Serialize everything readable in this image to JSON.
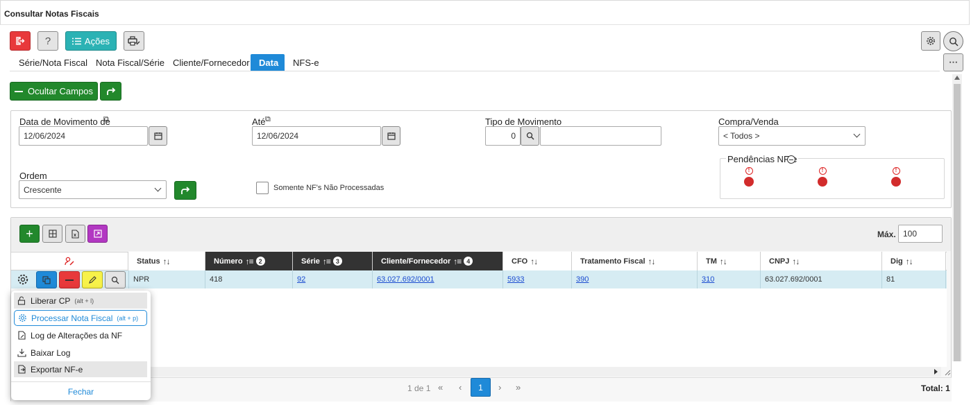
{
  "window": {
    "title": "Consultar Notas Fiscais"
  },
  "toolbar": {
    "acoes_label": "Ações",
    "help_label": "?"
  },
  "tabs": [
    {
      "label": "Série/Nota Fiscal",
      "active": false
    },
    {
      "label": "Nota Fiscal/Série",
      "active": false
    },
    {
      "label": "Cliente/Fornecedor",
      "active": false
    },
    {
      "label": "Data",
      "active": true
    },
    {
      "label": "NFS-e",
      "active": false
    }
  ],
  "actions": {
    "hide_fields_label": "Ocultar Campos"
  },
  "filters": {
    "data_mov_label": "Data de Movimento de",
    "data_mov_value": "12/06/2024",
    "ate_label": "Até",
    "ate_value": "12/06/2024",
    "tipo_mov_label": "Tipo de Movimento",
    "tipo_mov_value": "0",
    "compra_venda_label": "Compra/Venda",
    "compra_venda_value": "< Todos >",
    "ordem_label": "Ordem",
    "ordem_value": "Crescente",
    "somente_label": "Somente NF's Não Processadas",
    "pendencias_label": "Pendências NF-e"
  },
  "grid": {
    "max_label": "Máx.",
    "max_value": "100",
    "headers": {
      "status": "Status",
      "numero": "Número",
      "numero_badge": "2",
      "serie": "Série",
      "serie_badge": "3",
      "cliente": "Cliente/Fornecedor",
      "cliente_badge": "4",
      "cfo": "CFO",
      "tratamento": "Tratamento Fiscal",
      "tm": "TM",
      "cnpj": "CNPJ",
      "dig": "Dig"
    },
    "row": {
      "status": "NPR",
      "numero": "418",
      "serie": "92",
      "cliente": "63.027.692/0001",
      "cfo": "5933",
      "tratamento": "390",
      "tm": "310",
      "cnpj": "63.027.692/0001",
      "dig": "81"
    }
  },
  "pagination": {
    "info": "1 de 1",
    "page": "1",
    "total": "Total: 1"
  },
  "context_menu": {
    "items": [
      {
        "label": "Liberar CP",
        "shortcut": "(alt + l)"
      },
      {
        "label": "Processar Nota Fiscal",
        "shortcut": "(alt + p)"
      },
      {
        "label": "Log de Alterações da NF",
        "shortcut": ""
      },
      {
        "label": "Baixar Log",
        "shortcut": ""
      },
      {
        "label": "Exportar NF-e",
        "shortcut": ""
      }
    ],
    "close_label": "Fechar"
  },
  "colors": {
    "accent": "#1f8ad8",
    "green": "#22882c",
    "red": "#e8393b",
    "teal": "#2bb2b4"
  }
}
